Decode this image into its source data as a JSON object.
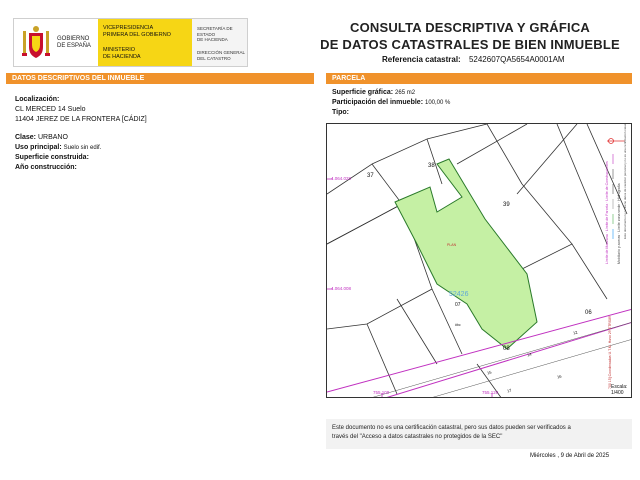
{
  "header": {
    "gobierno": [
      "GOBIERNO",
      "DE ESPAÑA"
    ],
    "vicepresidencia": [
      "VICEPRESIDENCIA",
      "PRIMERA DEL GOBIERNO"
    ],
    "ministerio": [
      "MINISTERIO",
      "DE HACIENDA"
    ],
    "secretaria": [
      "SECRETARÍA DE ESTADO",
      "DE HACIENDA"
    ],
    "direccion": [
      "DIRECCIÓN GENERAL",
      "DEL CATASTRO"
    ],
    "title_line1": "CONSULTA DESCRIPTIVA Y GRÁFICA",
    "title_line2": "DE DATOS CATASTRALES DE BIEN INMUEBLE",
    "ref_label": "Referencia catastral:",
    "ref_value": "5242607QA5654A0001AM",
    "brand_color": "#f0922b",
    "flag_yellow": "#f6d615"
  },
  "left": {
    "section_title": "DATOS DESCRIPTIVOS DEL INMUEBLE",
    "localizacion_label": "Localización:",
    "address_line1": "CL MERCED 14 Suelo",
    "address_line2": "11404 JEREZ DE LA FRONTERA [CÁDIZ]",
    "clase_label": "Clase:",
    "clase_value": "URBANO",
    "uso_label": "Uso principal:",
    "uso_value": "Suelo sin edif.",
    "superficie_label": "Superficie construida:",
    "anio_label": "Año construcción:"
  },
  "right": {
    "section_title": "PARCELA",
    "sup_label": "Superficie gráfica:",
    "sup_value": "265 m2",
    "part_label": "Participación del inmueble:",
    "part_value": "100,00 %",
    "tipo_label": "Tipo:"
  },
  "map": {
    "parcel_color": "#c5f0a4",
    "parcel_label": "PLAN",
    "parcel_number": "52426",
    "parcel_code": "07",
    "parcel_sub": "#bc",
    "neighbors": [
      "37",
      "38",
      "39",
      "06",
      "08"
    ],
    "coords_y": [
      "4.064.028",
      "4.064.008"
    ],
    "coords_x": [
      "755.100",
      "755.120"
    ],
    "street_numbers": [
      "12",
      "14",
      "16",
      "17",
      "15"
    ],
    "legend_lines": [
      "Límite de Manzana",
      "Límite de Parcela",
      "Límite de Construcciones",
      "Mobiliario y aceras",
      "Límite zona verde",
      "Hidrografía"
    ],
    "disclaimer_side": "Este documento no contiene datos de carácter personal y no es una certificación catastral. Para certificar estos datos use el código de verificación",
    "coord_side": "700 15] Coordenadas U.T.M. Huso 29 ETRS89",
    "scale_label": "Escala:",
    "scale_value": "1/400"
  },
  "footer": {
    "notice_line1": "Este documento no es una certificación catastral, pero sus datos pueden ser verificados a",
    "notice_line2": "través del \"Acceso a datos catastrales no protegidos de la SEC\"",
    "date": "Miércoles , 9 de Abril de 2025"
  }
}
